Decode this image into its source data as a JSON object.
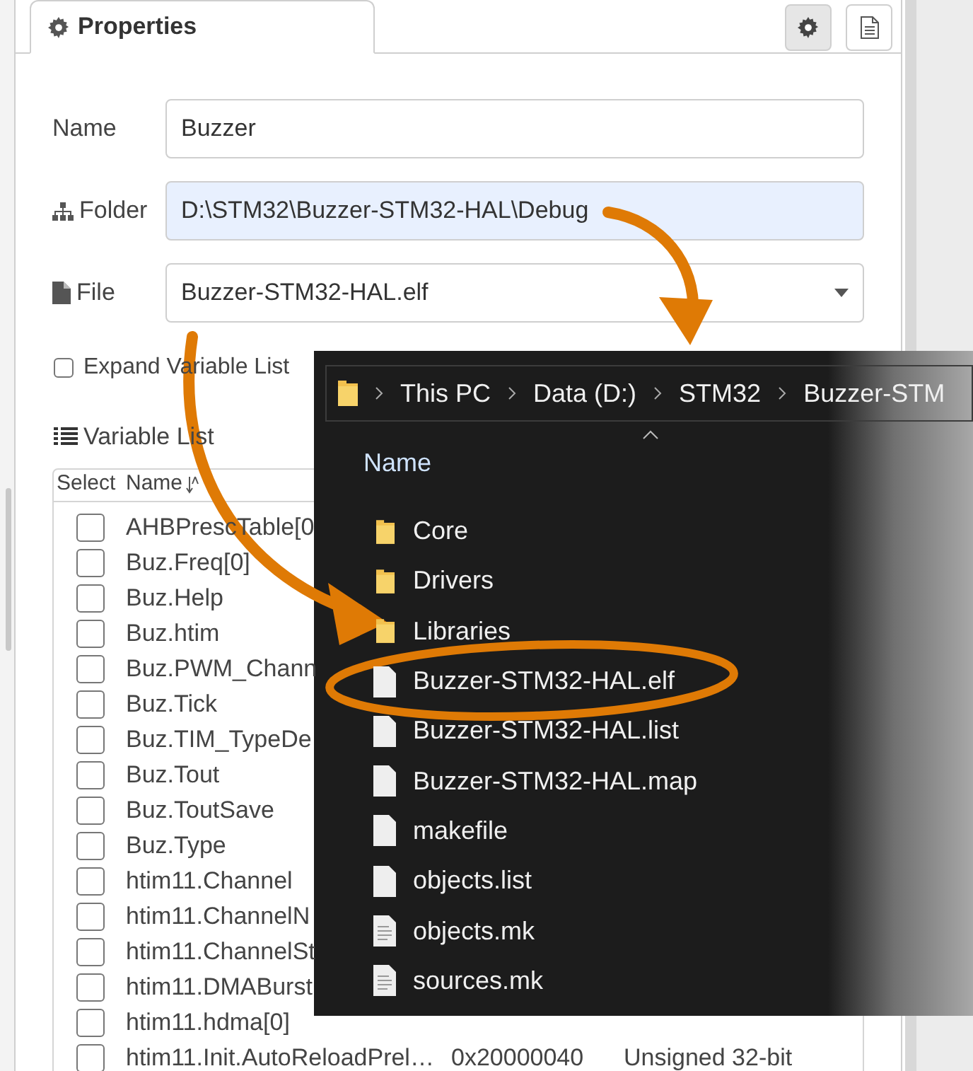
{
  "panel": {
    "tabs": [
      {
        "label": "Properties",
        "selected": true
      }
    ],
    "toolbar_buttons": [
      {
        "kind": "settings",
        "selected": true
      },
      {
        "kind": "document",
        "selected": false
      }
    ],
    "fields": [
      {
        "kind": "text",
        "label": "Name",
        "value": "Buzzer",
        "highlighted": false
      },
      {
        "kind": "folder",
        "label": "Folder",
        "value": "D:\\STM32\\Buzzer-STM32-HAL\\Debug",
        "highlighted": true
      },
      {
        "kind": "file",
        "label": "File",
        "value": "Buzzer-STM32-HAL.elf",
        "highlighted": false
      }
    ],
    "expand_option": {
      "label": "Expand Variable List",
      "checked": false
    },
    "variable_list": {
      "title": "Variable List",
      "columns": [
        "Select",
        "Name"
      ],
      "rows": [
        {
          "checked": false,
          "name": "AHBPrescTable[0"
        },
        {
          "checked": false,
          "name": "Buz.Freq[0]"
        },
        {
          "checked": false,
          "name": "Buz.Help"
        },
        {
          "checked": false,
          "name": "Buz.htim"
        },
        {
          "checked": false,
          "name": "Buz.PWM_Chann"
        },
        {
          "checked": false,
          "name": "Buz.Tick"
        },
        {
          "checked": false,
          "name": "Buz.TIM_TypeDe"
        },
        {
          "checked": false,
          "name": "Buz.Tout"
        },
        {
          "checked": false,
          "name": "Buz.ToutSave"
        },
        {
          "checked": false,
          "name": "Buz.Type"
        },
        {
          "checked": false,
          "name": "htim11.Channel"
        },
        {
          "checked": false,
          "name": "htim11.ChannelN"
        },
        {
          "checked": false,
          "name": "htim11.ChannelSt"
        },
        {
          "checked": false,
          "name": "htim11.DMABurst"
        },
        {
          "checked": false,
          "name": "htim11.hdma[0]"
        },
        {
          "checked": false,
          "name": "htim11.Init.AutoReloadPrel…",
          "address": "0x20000040",
          "type": "Unsigned 32-bit"
        }
      ]
    }
  },
  "explorer": {
    "breadcrumb": [
      "This PC",
      "Data (D:)",
      "STM32",
      "Buzzer-STM"
    ],
    "column": "Name",
    "items": [
      {
        "kind": "folder",
        "name": "Core"
      },
      {
        "kind": "folder",
        "name": "Drivers"
      },
      {
        "kind": "folder",
        "name": "Libraries"
      },
      {
        "kind": "file",
        "name": "Buzzer-STM32-HAL.elf"
      },
      {
        "kind": "file",
        "name": "Buzzer-STM32-HAL.list"
      },
      {
        "kind": "file",
        "name": "Buzzer-STM32-HAL.map"
      },
      {
        "kind": "file",
        "name": "makefile"
      },
      {
        "kind": "file",
        "name": "objects.list"
      },
      {
        "kind": "text-file",
        "name": "objects.mk"
      },
      {
        "kind": "text-file",
        "name": "sources.mk"
      }
    ]
  }
}
